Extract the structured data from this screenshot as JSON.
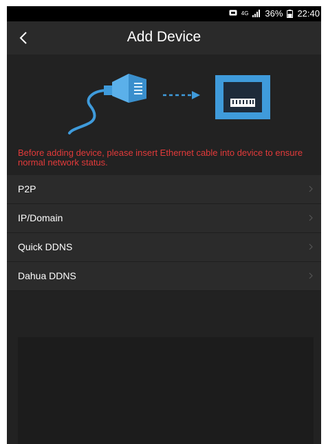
{
  "status_bar": {
    "network": "4G",
    "battery": "36%",
    "time": "22:40"
  },
  "header": {
    "title": "Add Device"
  },
  "notice": "Before adding device, please insert Ethernet cable into device to ensure normal network status.",
  "menu": {
    "items": [
      {
        "label": "P2P"
      },
      {
        "label": "IP/Domain"
      },
      {
        "label": "Quick DDNS"
      },
      {
        "label": "Dahua DDNS"
      }
    ]
  },
  "colors": {
    "accent_blue": "#3f9bdb",
    "notice_red": "#e23a3a"
  },
  "icons": [
    "back-arrow-icon",
    "ethernet-cable-icon",
    "dashed-arrow-icon",
    "ethernet-port-icon",
    "chevron-right-icon"
  ]
}
